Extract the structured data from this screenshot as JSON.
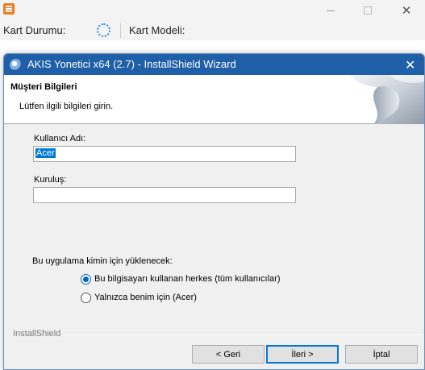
{
  "bg_app": {
    "toolbar": {
      "card_status_label": "Kart Durumu:",
      "card_model_label": "Kart Modeli:"
    }
  },
  "wizard": {
    "title": "AKIS Yonetici x64 (2.7) - InstallShield Wizard",
    "header": {
      "title": "Müşteri Bilgileri",
      "subtitle": "Lütfen ilgili bilgileri girin."
    },
    "fields": {
      "username": {
        "label": "Kullanıcı Adı:",
        "value": "Acer"
      },
      "organization": {
        "label": "Kuruluş:",
        "value": ""
      }
    },
    "install_for": {
      "question": "Bu uygulama kimin için yüklenecek:",
      "options": [
        {
          "label": "Bu bilgisayarı kullanan herkes (tüm kullanıcılar)",
          "selected": true
        },
        {
          "label": "Yalnızca benim için (Acer)",
          "selected": false
        }
      ]
    },
    "brand": "InstallShield",
    "buttons": {
      "back": "< Geri",
      "next": "İleri >",
      "cancel": "İptal"
    }
  },
  "colors": {
    "title_bar": "#1f5fa8",
    "accent": "#0078d7",
    "app_logo": "#f07c1b"
  }
}
